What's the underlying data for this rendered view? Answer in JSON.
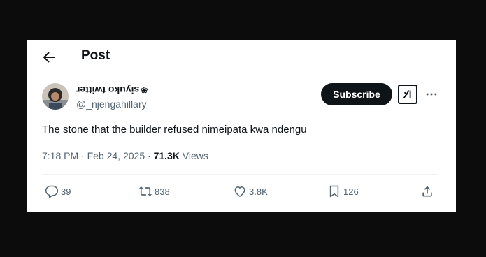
{
  "header": {
    "title": "Post",
    "back_icon": "arrow-left-icon"
  },
  "author": {
    "display_name_flipped": "siyuko twitter",
    "display_name_emoji": "❀",
    "handle": "@_njengahillary",
    "avatar_icon": "avatar"
  },
  "buttons": {
    "subscribe": "Subscribe",
    "grok_icon": "grok-icon",
    "more_icon": "more-icon"
  },
  "tweet": {
    "text": "The stone that the builder refused nimeipata kwa ndengu",
    "time": "7:18 PM",
    "separator": " · ",
    "date": "Feb 24, 2025",
    "views": "71.3K",
    "views_label": " Views"
  },
  "actions": {
    "replies": "39",
    "reposts": "838",
    "likes": "3.8K",
    "bookmarks": "126"
  },
  "colors": {
    "text": "#0f1419",
    "secondary": "#536471",
    "background": "#ffffff",
    "frame": "#0c0c0c"
  }
}
